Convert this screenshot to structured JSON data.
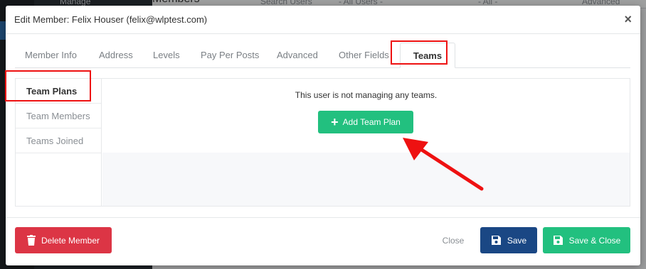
{
  "background": {
    "page_title": "Members",
    "nav_item": "Manage",
    "search_placeholder": "Search Users",
    "filter_users": "- All Users -",
    "filter_all": "- All -",
    "advanced_search": "Advanced Search"
  },
  "modal": {
    "title": "Edit Member: Felix Houser (felix@wlptest.com)",
    "close_symbol": "×",
    "tabs": [
      {
        "label": "Member Info"
      },
      {
        "label": "Address"
      },
      {
        "label": "Levels"
      },
      {
        "label": "Pay Per Posts"
      },
      {
        "label": "Advanced"
      },
      {
        "label": "Other Fields"
      },
      {
        "label": "Teams",
        "active": true
      }
    ],
    "subnav": [
      {
        "label": "Team Plans",
        "active": true
      },
      {
        "label": "Team Members"
      },
      {
        "label": "Teams Joined"
      }
    ],
    "empty_message": "This user is not managing any teams.",
    "add_button": "Add Team Plan",
    "footer": {
      "delete": "Delete Member",
      "close": "Close",
      "save": "Save",
      "save_close": "Save & Close"
    }
  },
  "colors": {
    "highlight": "#ee1111",
    "primary_green": "#22c07f",
    "save_blue": "#1a4784",
    "danger": "#dc3545"
  }
}
